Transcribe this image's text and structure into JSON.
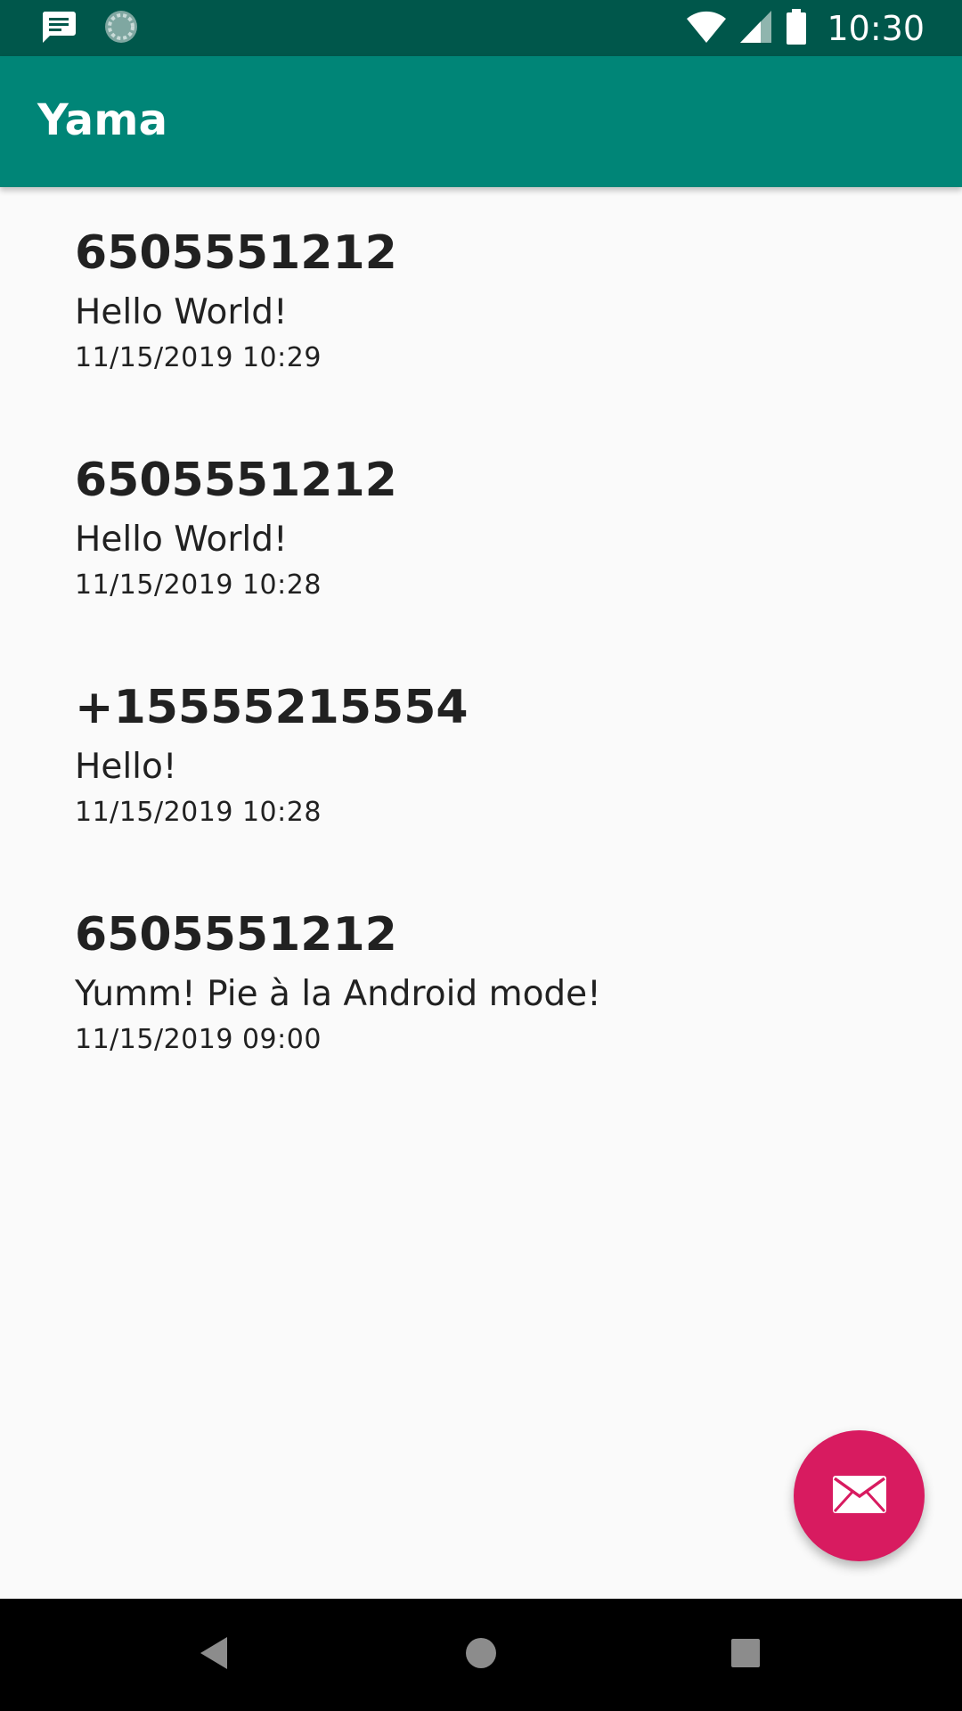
{
  "status_bar": {
    "time": "10:30",
    "icons": [
      "message-notification-icon",
      "sync-icon",
      "wifi-icon",
      "signal-icon",
      "battery-icon"
    ]
  },
  "app_bar": {
    "title": "Yama"
  },
  "messages": [
    {
      "sender": "6505551212",
      "body": "Hello World!",
      "date": "11/15/2019 10:29"
    },
    {
      "sender": "6505551212",
      "body": "Hello World!",
      "date": "11/15/2019 10:28"
    },
    {
      "sender": "+15555215554",
      "body": "Hello!",
      "date": "11/15/2019 10:28"
    },
    {
      "sender": "6505551212",
      "body": "Yumm! Pie à la Android mode!",
      "date": "11/15/2019 09:00"
    }
  ],
  "fab": {
    "icon": "mail-icon"
  },
  "nav_bar": {
    "icons": [
      "back-icon",
      "home-icon",
      "recents-icon"
    ]
  },
  "colors": {
    "status_bar": "#00574b",
    "app_bar": "#008577",
    "fab": "#d81b60",
    "background": "#fafafa",
    "text": "#212121"
  }
}
